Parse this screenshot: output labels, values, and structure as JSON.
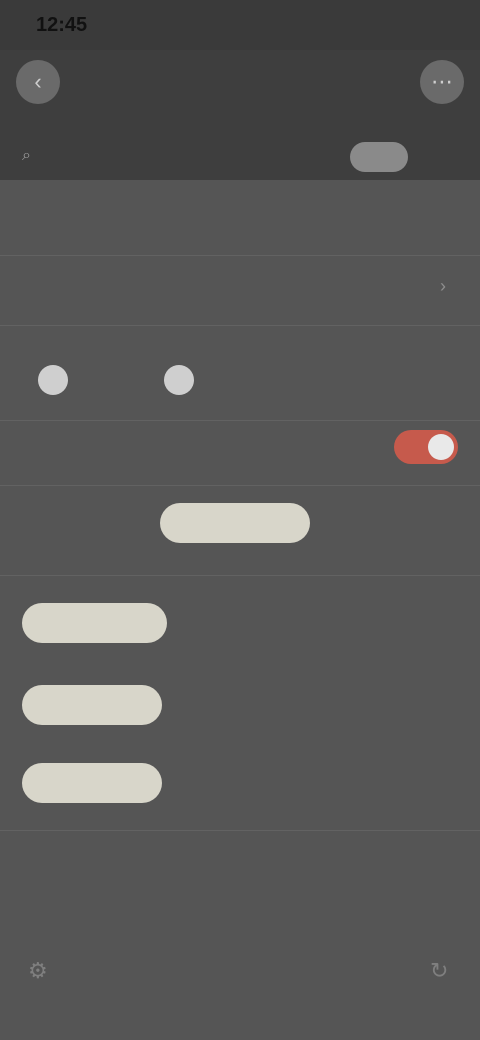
{
  "status_bar": {
    "time": "12:45"
  },
  "topbar": {
    "back_icon": "back-circle-icon",
    "center_title": "",
    "menu_icon": "more-circle-icon",
    "tab_left_label": "",
    "tab_right_label": ""
  },
  "section": {
    "title": ""
  },
  "rows": [
    {
      "label": ""
    },
    {
      "label": ""
    },
    {
      "label": ""
    }
  ],
  "radios": [
    {
      "label": ""
    },
    {
      "label": ""
    }
  ],
  "toggle_row": {
    "label": "",
    "enabled": true
  },
  "segmented": {
    "left_label": "",
    "middle_pill_label": "",
    "right_label": ""
  },
  "list": [
    {
      "pill_label": "",
      "a": "",
      "b": ""
    },
    {
      "pill_label": "",
      "a": "",
      "b": ""
    },
    {
      "pill_label": "",
      "a": "",
      "b": ""
    }
  ],
  "footer": {
    "line1": "",
    "line2": "",
    "line3": "",
    "left_icon": "settings-icon",
    "right_icon": "refresh-icon"
  },
  "colors": {
    "background": "#555555",
    "accent_toggle": "#c65a4c",
    "pill_bg": "#d8d6ca"
  }
}
